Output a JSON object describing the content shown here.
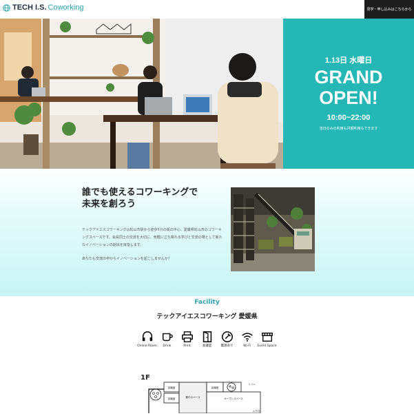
{
  "header": {
    "brand": "TECH I.S.",
    "brand_sub": "Coworking",
    "cta_label": "見学・申し込みはこちらから"
  },
  "hero": {
    "date": "1.13日 水曜日",
    "grand_line1": "GRAND",
    "grand_line2": "OPEN!",
    "hours": "10:00~22:00",
    "note": "当日のみの利用も月額利用もできます"
  },
  "intro": {
    "heading_line1": "誰でも使えるコワーキングで",
    "heading_line2": "未来を創ろう",
    "paragraph1": "テックアイエスコワーキングは松山市駅から徒歩5分の街の中心、愛媛県松山市のコワーキングスペースです。会員同士の交流を大切に、気軽に立ち寄れる学びと交流の場として新たなイノベーションの創出を目指します。",
    "paragraph2": "あなたも交流の中からイノベーションを起こしませんか？"
  },
  "facility": {
    "title": "Facility",
    "subtitle": "テックアイエスコワーキング 愛媛県",
    "icons": [
      {
        "name": "headset-icon",
        "label": "Online Room"
      },
      {
        "name": "cup-icon",
        "label": "Drink"
      },
      {
        "name": "printer-icon",
        "label": "Print"
      },
      {
        "name": "door-icon",
        "label": "会議室"
      },
      {
        "name": "plug-icon",
        "label": "電源あり"
      },
      {
        "name": "wifi-icon",
        "label": "Wi-Fi"
      },
      {
        "name": "event-icon",
        "label": "Event Space"
      }
    ]
  },
  "floor": {
    "label": "1F",
    "rooms": {
      "meeting_a": "会議室",
      "meeting_b": "会議室",
      "meeting_c": "会議室",
      "focus": "集中スペース",
      "open": "オープンスペース",
      "toilet": "トイレ",
      "entrance": "入り口"
    }
  },
  "colors": {
    "teal": "#24b7b5",
    "accent_text": "#2aa3b0",
    "dark": "#1d1d1d"
  }
}
